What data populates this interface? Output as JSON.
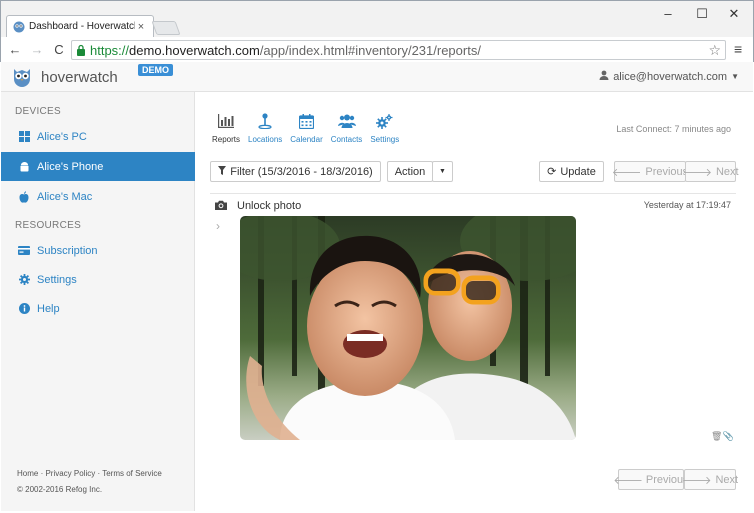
{
  "browser": {
    "tab_title": "Dashboard - Hoverwatch",
    "tab_close": "×",
    "url_scheme": "https://",
    "url_host": "demo.hoverwatch.com",
    "url_path": "/app/index.html#inventory/231/reports/",
    "minimize": "–",
    "maximize": "☐",
    "close": "✕"
  },
  "header": {
    "brand": "hoverwatch",
    "demo_badge": "DEMO",
    "user_email": "alice@hoverwatch.com"
  },
  "sidebar": {
    "devices_title": "DEVICES",
    "devices": [
      {
        "label": "Alice's PC"
      },
      {
        "label": "Alice's Phone"
      },
      {
        "label": "Alice's Mac"
      }
    ],
    "resources_title": "RESOURCES",
    "resources": [
      {
        "label": "Subscription"
      },
      {
        "label": "Settings"
      },
      {
        "label": "Help"
      }
    ],
    "footer_links": "Home · Privacy Policy · Terms of Service",
    "copyright": "© 2002-2016 Refog Inc."
  },
  "main": {
    "nav": [
      {
        "label": "Reports"
      },
      {
        "label": "Locations"
      },
      {
        "label": "Calendar"
      },
      {
        "label": "Contacts"
      },
      {
        "label": "Settings"
      }
    ],
    "last_connect": "Last Connect: 7 minutes ago",
    "filter_label": "Filter (15/3/2016 - 18/3/2016)",
    "action_label": "Action",
    "update_label": "Update",
    "previous_label": "Previous",
    "next_label": "Next",
    "bottom_previous_label": "Previous",
    "bottom_next_label": "Next",
    "entry_title": "Unlock photo",
    "entry_time": "Yesterday at 17:19:47"
  },
  "colors": {
    "accent": "#2d84c4",
    "demo_badge": "#3a8fd6"
  }
}
